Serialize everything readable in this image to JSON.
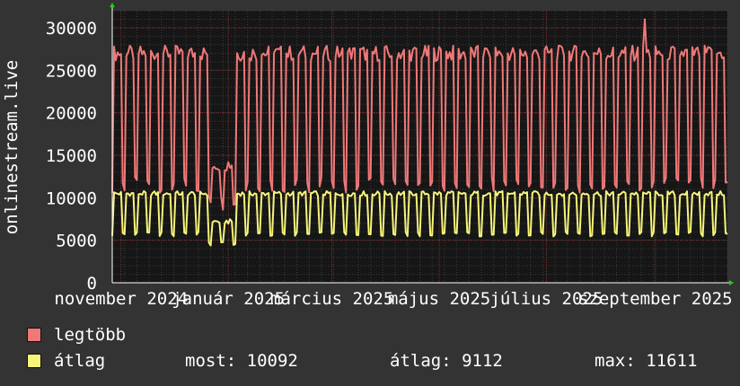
{
  "chart_data": {
    "type": "line",
    "ylabel": "onlinestream.live",
    "ylim": [
      0,
      32000
    ],
    "yticks": [
      0,
      5000,
      10000,
      15000,
      20000,
      25000,
      30000
    ],
    "x_range": [
      "2024-10-27",
      "2025-10-12"
    ],
    "x_tick_labels": [
      {
        "date": "2024-11-01",
        "label": "november 2024"
      },
      {
        "date": "2025-01-01",
        "label": "január 2025"
      },
      {
        "date": "2025-03-01",
        "label": "március 2025"
      },
      {
        "date": "2025-05-01",
        "label": "május 2025"
      },
      {
        "date": "2025-07-01",
        "label": "július 2025"
      },
      {
        "date": "2025-09-01",
        "label": "szeptember 2025"
      }
    ],
    "grid": true,
    "legend_position": "bottom-left",
    "series": [
      {
        "name": "legtöbb",
        "color": "#f07878",
        "weekday_peak": 27000,
        "weekend_low": 11500,
        "holiday_dip": {
          "from": "2024-12-21",
          "to": "2025-01-05",
          "peak": 14000,
          "low": 9500
        },
        "max_spike": {
          "date": "2025-08-26",
          "value": 31000
        }
      },
      {
        "name": "átlag",
        "color": "#f5f57a",
        "weekday_peak": 10500,
        "weekend_low": 5700,
        "holiday_dip": {
          "from": "2024-12-21",
          "to": "2025-01-05",
          "peak": 7200,
          "low": 4500
        },
        "stats": {
          "most": "10092",
          "atlag": "9112",
          "max": "11611"
        }
      }
    ]
  },
  "legend": {
    "items": [
      {
        "label": "legtöbb",
        "color": "#f07878"
      },
      {
        "label": "átlag",
        "color": "#f5f57a"
      }
    ],
    "stats": {
      "most_label": "most:",
      "most_value": "10092",
      "atlag_label": "átlag:",
      "atlag_value": "9112",
      "max_label": "max:",
      "max_value": "11611"
    }
  }
}
